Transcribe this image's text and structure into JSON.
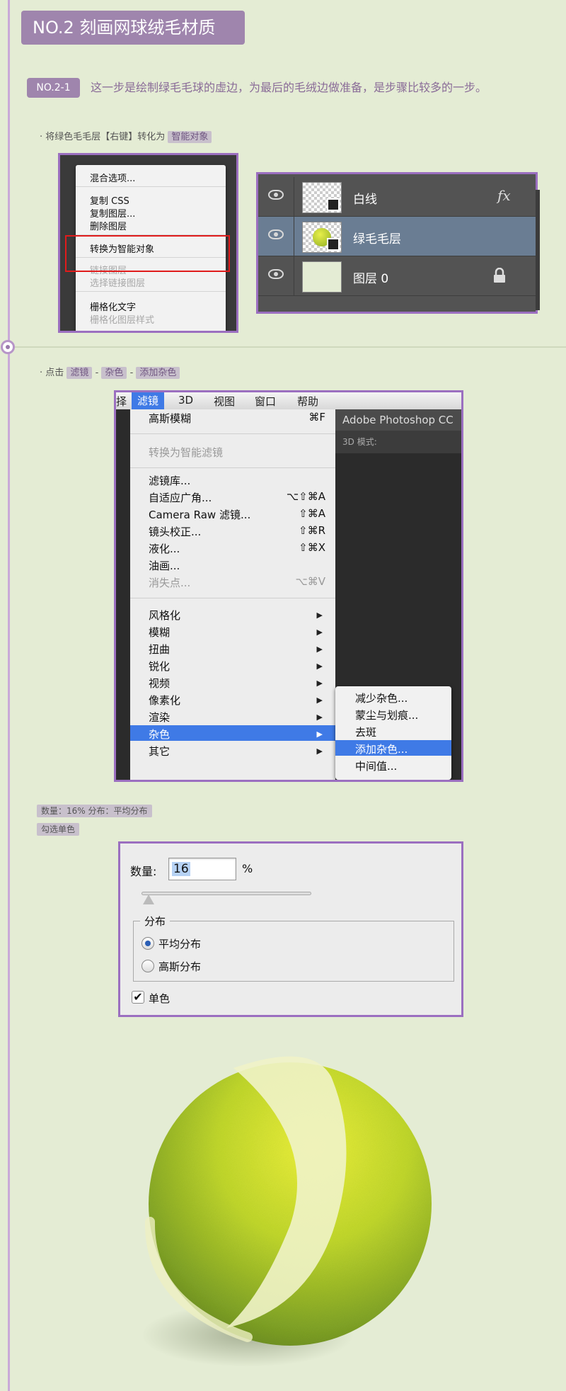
{
  "section": {
    "title": "NO.2  刻画网球绒毛材质"
  },
  "step": {
    "tag": "NO.2-1",
    "description": "这一步是绘制绿毛毛球的虚边，为最后的毛绒边做准备，是步骤比较多的一步。"
  },
  "instructions": {
    "convert_prefix": "· 将绿色毛毛层【右键】转化为",
    "convert_highlight": "智能对象",
    "click_prefix": "· 点击",
    "path_1": "滤镜",
    "sep": "-",
    "path_2": "杂色",
    "path_3": "添加杂色"
  },
  "context_menu": {
    "items": [
      "混合选项...",
      "复制 CSS",
      "复制图层...",
      "删除图层",
      "转换为智能对象",
      "链接图层",
      "选择链接图层",
      "栅格化文字",
      "栅格化图层样式"
    ]
  },
  "layers_panel": {
    "layers": [
      {
        "name": "白线",
        "badge": "fx"
      },
      {
        "name": "绿毛毛层",
        "badge": ""
      },
      {
        "name": "图层 0",
        "badge": "lock-icon"
      }
    ]
  },
  "menubar": {
    "items": [
      "择",
      "滤镜",
      "3D",
      "视图",
      "窗口",
      "帮助"
    ]
  },
  "ps_app_title": "Adobe Photoshop CC",
  "ps_options": "3D 模式:",
  "filter_menu": {
    "items": [
      {
        "label": "高斯模糊",
        "shortcut": "⌘F"
      },
      {
        "label": "转换为智能滤镜",
        "shortcut": ""
      },
      {
        "label": "滤镜库...",
        "shortcut": ""
      },
      {
        "label": "自适应广角...",
        "shortcut": "⌥⇧⌘A"
      },
      {
        "label": "Camera Raw 滤镜...",
        "shortcut": "⇧⌘A"
      },
      {
        "label": "镜头校正...",
        "shortcut": "⇧⌘R"
      },
      {
        "label": "液化...",
        "shortcut": "⇧⌘X"
      },
      {
        "label": "油画...",
        "shortcut": ""
      },
      {
        "label": "消失点...",
        "shortcut": "⌥⌘V"
      },
      {
        "label": "风格化",
        "shortcut": "▶"
      },
      {
        "label": "模糊",
        "shortcut": "▶"
      },
      {
        "label": "扭曲",
        "shortcut": "▶"
      },
      {
        "label": "锐化",
        "shortcut": "▶"
      },
      {
        "label": "视频",
        "shortcut": "▶"
      },
      {
        "label": "像素化",
        "shortcut": "▶"
      },
      {
        "label": "渲染",
        "shortcut": "▶"
      },
      {
        "label": "杂色",
        "shortcut": "▶"
      },
      {
        "label": "其它",
        "shortcut": "▶"
      }
    ]
  },
  "noise_submenu": {
    "items": [
      "减少杂色...",
      "蒙尘与划痕...",
      "去斑",
      "添加杂色...",
      "中间值..."
    ]
  },
  "params": {
    "line1": "数量：16%  分布：平均分布",
    "line2": "勾选单色"
  },
  "noise_dialog": {
    "amount_label": "数量:",
    "amount_value": "16",
    "unit": "%",
    "distribution_label": "分布",
    "uniform": "平均分布",
    "gaussian": "高斯分布",
    "mono": "单色",
    "check": "✔"
  },
  "colors": {
    "accent": "#9f85ad",
    "highlight_blue": "#3f7ae6",
    "ball_green": "#b8d231"
  }
}
